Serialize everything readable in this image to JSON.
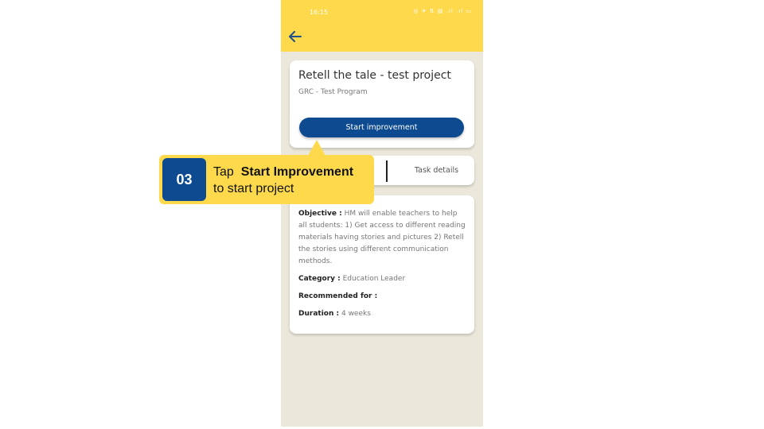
{
  "status_bar": {
    "time": "16:15",
    "icons": "◎ ✈ ⇅ ▤ .ıl .ıl ▭"
  },
  "header": {
    "back_icon": "arrow-left-icon",
    "back_color": "#1f4f8f",
    "background": "#fdd94b"
  },
  "project": {
    "title": "Retell the tale - test project",
    "program": "GRC - Test Program",
    "start_button": "Start improvement"
  },
  "tabs": {
    "task_details": "Task details"
  },
  "details": {
    "objective_label": "Objective :",
    "objective_text": "HM will enable teachers to help all students: 1) Get access to different reading materials having stories and pictures 2) Retell the stories using different communication methods.",
    "category_label": "Category :",
    "category_value": "Education Leader",
    "recommended_label": "Recommended for :",
    "duration_label": "Duration :",
    "duration_value": "4 weeks"
  },
  "callout": {
    "step": "03",
    "line1_prefix": "Tap",
    "line1_bold": "Start Improvement",
    "line2": "to start project"
  },
  "colors": {
    "accent_yellow": "#fdd94b",
    "brand_blue": "#0d4a8f",
    "app_bg": "#ebe7da"
  }
}
